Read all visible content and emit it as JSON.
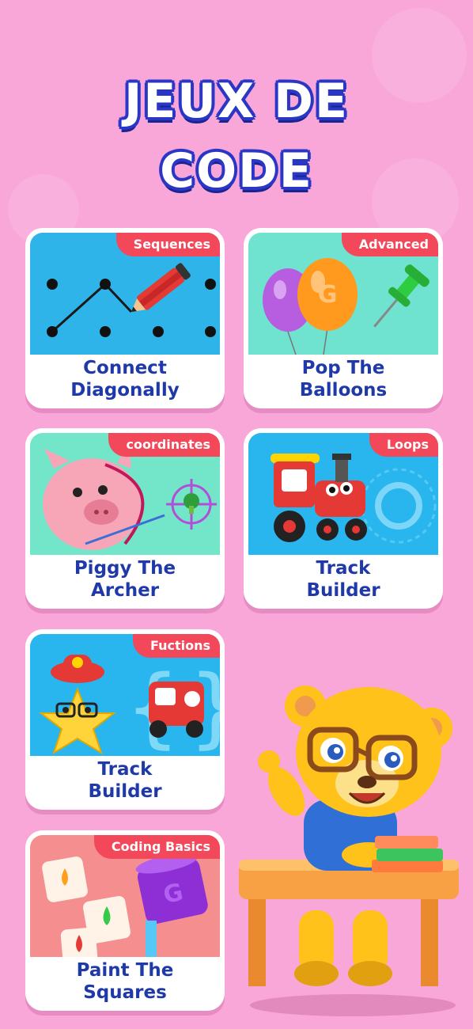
{
  "title": {
    "line1": "JEUX DE",
    "line2": "CODE"
  },
  "cards": [
    {
      "tag": "Sequences",
      "label": "Connect\nDiagonally"
    },
    {
      "tag": "Advanced",
      "label": "Pop The\nBalloons"
    },
    {
      "tag": "coordinates",
      "label": "Piggy The\nArcher"
    },
    {
      "tag": "Loops",
      "label": "Track\nBuilder"
    },
    {
      "tag": "Fuctions",
      "label": "Track\nBuilder"
    },
    {
      "tag": "Coding Basics",
      "label": "Paint The\nSquares"
    }
  ],
  "colors": {
    "background": "#f9a6d8",
    "title_outline": "#2a36c6",
    "tag": "#f2485a",
    "label": "#1f3aa8"
  }
}
